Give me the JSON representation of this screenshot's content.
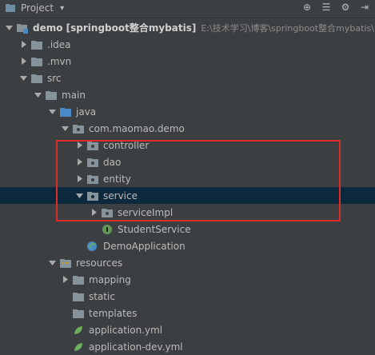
{
  "toolbar": {
    "title": "Project"
  },
  "tree": [
    {
      "label": "demo [springboot整合mybatis]",
      "path": "E:\\技术学习\\博客\\springboot整合mybatis\\",
      "arrow": "down",
      "icon": "module"
    },
    {
      "label": ".idea",
      "arrow": "right",
      "icon": "folder"
    },
    {
      "label": ".mvn",
      "arrow": "right",
      "icon": "folder"
    },
    {
      "label": "src",
      "arrow": "down",
      "icon": "folder"
    },
    {
      "label": "main",
      "arrow": "down",
      "icon": "folder"
    },
    {
      "label": "java",
      "arrow": "down",
      "icon": "folder-blue"
    },
    {
      "label": "com.maomao.demo",
      "arrow": "down",
      "icon": "package"
    },
    {
      "label": "controller",
      "arrow": "right",
      "icon": "package"
    },
    {
      "label": "dao",
      "arrow": "right",
      "icon": "package"
    },
    {
      "label": "entity",
      "arrow": "right",
      "icon": "package"
    },
    {
      "label": "service",
      "arrow": "down",
      "icon": "package"
    },
    {
      "label": "serviceImpl",
      "arrow": "right",
      "icon": "package"
    },
    {
      "label": "StudentService",
      "arrow": "none",
      "icon": "interface"
    },
    {
      "label": "DemoApplication",
      "arrow": "none",
      "icon": "spring-class"
    },
    {
      "label": "resources",
      "arrow": "down",
      "icon": "resources"
    },
    {
      "label": "mapping",
      "arrow": "right",
      "icon": "folder"
    },
    {
      "label": "static",
      "arrow": "none",
      "icon": "folder"
    },
    {
      "label": "templates",
      "arrow": "none",
      "icon": "folder"
    },
    {
      "label": "application.yml",
      "arrow": "none",
      "icon": "yml"
    },
    {
      "label": "application-dev.yml",
      "arrow": "none",
      "icon": "yml"
    }
  ]
}
